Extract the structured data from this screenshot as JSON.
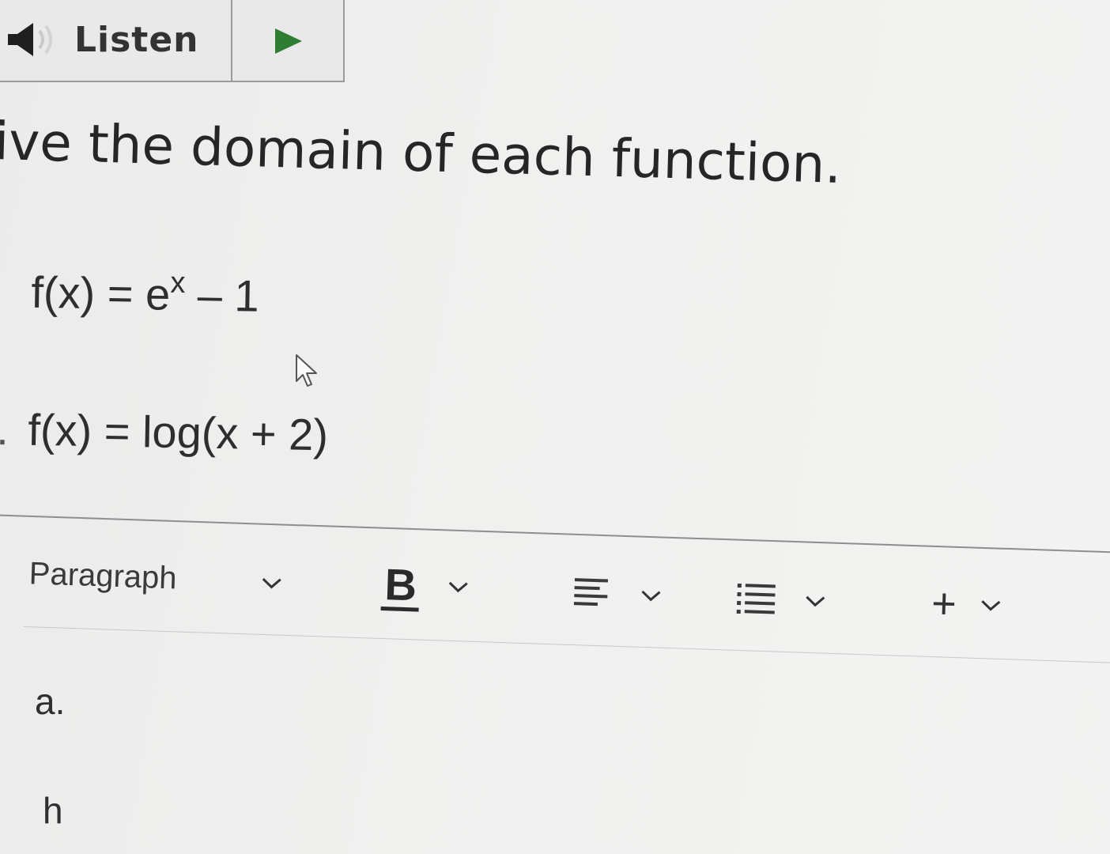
{
  "listen_bar": {
    "label": "Listen",
    "speaker_icon": "speaker-icon",
    "play_icon": "play-icon",
    "play_color": "#2e7d32"
  },
  "question": {
    "instruction": "ive the domain of each function.",
    "problems": [
      {
        "marker": "",
        "lhs": "f(x) = e",
        "superscript": "x",
        "rhs": " – 1"
      },
      {
        "marker": ".",
        "expression": "f(x) = log(x + 2)"
      }
    ]
  },
  "editor": {
    "toolbar": {
      "paragraph_label": "Paragraph",
      "bold_label": "B",
      "align_icon": "align-left-icon",
      "list_icon": "bulleted-list-icon",
      "insert_label": "+",
      "chevron_icon": "chevron-down-icon"
    },
    "content_lines": [
      "a.",
      "h"
    ]
  }
}
